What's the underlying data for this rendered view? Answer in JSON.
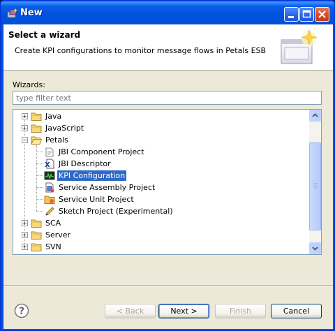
{
  "window": {
    "title": "New"
  },
  "header": {
    "title": "Select a wizard",
    "description": "Create KPI configurations to monitor message flows in Petals ESB"
  },
  "wizards_label": "Wizards:",
  "filter": {
    "placeholder": "type filter text",
    "value": ""
  },
  "tree": {
    "items": [
      {
        "label": "Java",
        "expanded": false,
        "icon": "folder-icon"
      },
      {
        "label": "JavaScript",
        "expanded": false,
        "icon": "folder-icon"
      },
      {
        "label": "Petals",
        "expanded": true,
        "icon": "folder-open-icon"
      },
      {
        "label": "JBI Component Project",
        "icon": "component-project-icon"
      },
      {
        "label": "JBI Descriptor",
        "icon": "xml-descriptor-icon"
      },
      {
        "label": "KPI Configuration",
        "icon": "kpi-chart-icon",
        "selected": true
      },
      {
        "label": "Service Assembly Project",
        "icon": "service-assembly-icon"
      },
      {
        "label": "Service Unit Project",
        "icon": "service-unit-icon"
      },
      {
        "label": "Sketch Project (Experimental)",
        "icon": "pencil-icon"
      },
      {
        "label": "SCA",
        "expanded": false,
        "icon": "folder-icon"
      },
      {
        "label": "Server",
        "expanded": false,
        "icon": "folder-icon"
      },
      {
        "label": "SVN",
        "expanded": false,
        "icon": "folder-icon"
      }
    ]
  },
  "buttons": {
    "back": "< Back",
    "next": "Next >",
    "finish": "Finish",
    "cancel": "Cancel"
  },
  "help_icon": "help-icon"
}
